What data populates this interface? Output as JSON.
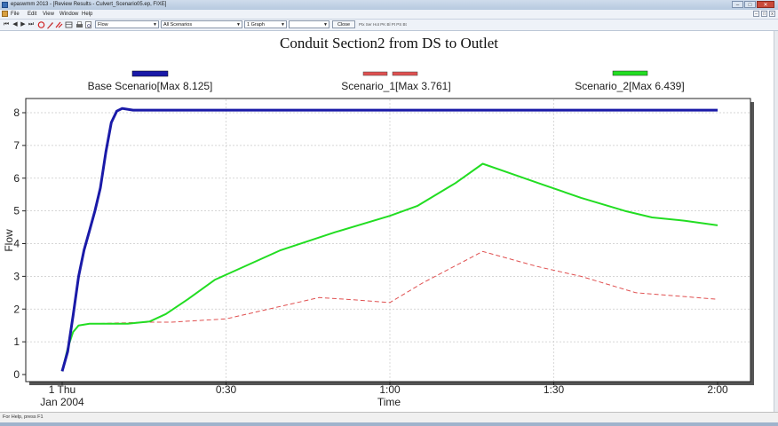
{
  "window": {
    "title": "epaswmm 2013 - [Review Results - Culvert_Scenario05.ep, FIXE]"
  },
  "window_buttons": {
    "minimize": "–",
    "maximize": "□",
    "close": "✕"
  },
  "menu": {
    "items": [
      "File",
      "Edit",
      "View",
      "Window",
      "Help"
    ],
    "mdi_min": "–",
    "mdi_restore": "□",
    "mdi_close": "x"
  },
  "toolbar": {
    "nav": [
      "⏮",
      "◀",
      "▶",
      "⏭"
    ],
    "variable_select": "Flow",
    "scenario_select": "All Scenarios",
    "graph_select": "1 Graph",
    "blank_select": "",
    "close_label": "Close",
    "extra_tools": "Ptx Ser Hot PK  Bl Pt PS Bt"
  },
  "status": {
    "text": "For Help, press F1"
  },
  "chart_data": {
    "type": "line",
    "title": "Conduit Section2 from DS to Outlet",
    "xlabel": "Time",
    "ylabel": "Flow",
    "xlim": [
      0,
      120
    ],
    "ylim": [
      0,
      8.4
    ],
    "x_ticks": [
      {
        "value": 0,
        "label": "1 Thu",
        "sublabel": "Jan 2004"
      },
      {
        "value": 30,
        "label": "0:30"
      },
      {
        "value": 60,
        "label": "1:00"
      },
      {
        "value": 90,
        "label": "1:30"
      },
      {
        "value": 120,
        "label": "2:00"
      }
    ],
    "y_ticks": [
      0,
      1,
      2,
      3,
      4,
      5,
      6,
      7,
      8
    ],
    "grid": true,
    "legend_position": "top",
    "series": [
      {
        "name": "Base Scenario[Max 8.125]",
        "color": "#1a1aa8",
        "style": "solid-thick",
        "points": [
          [
            0,
            0.1
          ],
          [
            1,
            0.7
          ],
          [
            2,
            1.8
          ],
          [
            3,
            3.0
          ],
          [
            4,
            3.8
          ],
          [
            5,
            4.4
          ],
          [
            6,
            5.0
          ],
          [
            7,
            5.7
          ],
          [
            8,
            6.8
          ],
          [
            9,
            7.7
          ],
          [
            10,
            8.05
          ],
          [
            11,
            8.13
          ],
          [
            13,
            8.08
          ],
          [
            20,
            8.08
          ],
          [
            40,
            8.08
          ],
          [
            80,
            8.08
          ],
          [
            120,
            8.08
          ]
        ]
      },
      {
        "name": "Scenario_1[Max 3.761]",
        "color": "#e05050",
        "style": "dashed",
        "points": [
          [
            0,
            0.1
          ],
          [
            1,
            0.8
          ],
          [
            2,
            1.3
          ],
          [
            3,
            1.5
          ],
          [
            5,
            1.55
          ],
          [
            16,
            1.6
          ],
          [
            20,
            1.6
          ],
          [
            30,
            1.7
          ],
          [
            47,
            2.35
          ],
          [
            52,
            2.3
          ],
          [
            60,
            2.2
          ],
          [
            66,
            2.8
          ],
          [
            77,
            3.76
          ],
          [
            87,
            3.3
          ],
          [
            95,
            3.0
          ],
          [
            105,
            2.5
          ],
          [
            120,
            2.3
          ]
        ]
      },
      {
        "name": "Scenario_2[Max 6.439]",
        "color": "#22dd22",
        "style": "solid",
        "points": [
          [
            0,
            0.1
          ],
          [
            1,
            0.8
          ],
          [
            2,
            1.3
          ],
          [
            3,
            1.5
          ],
          [
            5,
            1.55
          ],
          [
            12,
            1.55
          ],
          [
            16,
            1.62
          ],
          [
            19,
            1.85
          ],
          [
            23,
            2.3
          ],
          [
            28,
            2.9
          ],
          [
            34,
            3.35
          ],
          [
            40,
            3.8
          ],
          [
            50,
            4.35
          ],
          [
            60,
            4.85
          ],
          [
            65,
            5.15
          ],
          [
            72,
            5.85
          ],
          [
            77,
            6.44
          ],
          [
            82,
            6.15
          ],
          [
            88,
            5.8
          ],
          [
            95,
            5.4
          ],
          [
            103,
            5.0
          ],
          [
            108,
            4.8
          ],
          [
            114,
            4.7
          ],
          [
            120,
            4.56
          ]
        ]
      }
    ]
  }
}
